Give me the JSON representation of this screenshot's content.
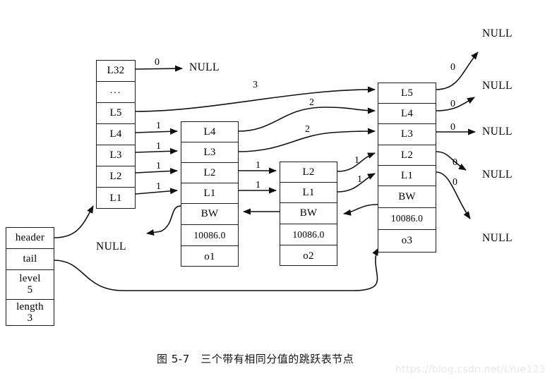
{
  "figure": {
    "caption": "图 5-7　三个带有相同分值的跳跃表节点",
    "watermark": "https://blog.csdn.net/LYue123"
  },
  "skiplist": {
    "meta_node": {
      "name": "skiplist-meta",
      "fields": [
        {
          "key": "header",
          "label": "header",
          "value": ""
        },
        {
          "key": "tail",
          "label": "tail",
          "value": ""
        },
        {
          "key": "level",
          "label": "level",
          "value": "5"
        },
        {
          "key": "length",
          "label": "length",
          "value": "3"
        }
      ]
    },
    "header_node": {
      "name": "header-node",
      "levels": [
        "L32",
        "...",
        "L5",
        "L4",
        "L3",
        "L2",
        "L1"
      ]
    },
    "nodes": [
      {
        "id": "o1",
        "levels": [
          "L4",
          "L3",
          "L2",
          "L1"
        ],
        "backward": "BW",
        "score": "10086.0",
        "obj": "o1"
      },
      {
        "id": "o2",
        "levels": [
          "L2",
          "L1"
        ],
        "backward": "BW",
        "score": "10086.0",
        "obj": "o2"
      },
      {
        "id": "o3",
        "levels": [
          "L5",
          "L4",
          "L3",
          "L2",
          "L1"
        ],
        "backward": "BW",
        "score": "10086.0",
        "obj": "o3"
      }
    ],
    "null_labels": [
      {
        "id": "null-header-l32",
        "text": "NULL"
      },
      {
        "id": "null-o1-backward",
        "text": "NULL"
      },
      {
        "id": "null-o3-l5",
        "text": "NULL"
      },
      {
        "id": "null-o3-l4",
        "text": "NULL"
      },
      {
        "id": "null-o3-l3",
        "text": "NULL"
      },
      {
        "id": "null-o3-l2",
        "text": "NULL"
      },
      {
        "id": "null-o3-l1",
        "text": "NULL"
      }
    ],
    "span_labels": [
      {
        "id": "span-header-l32",
        "value": "0"
      },
      {
        "id": "span-header-l5",
        "value": "3"
      },
      {
        "id": "span-header-l4",
        "value": "1"
      },
      {
        "id": "span-header-l3",
        "value": "1"
      },
      {
        "id": "span-header-l2",
        "value": "1"
      },
      {
        "id": "span-header-l1",
        "value": "1"
      },
      {
        "id": "span-o1-l4",
        "value": "2"
      },
      {
        "id": "span-o1-l3",
        "value": "2"
      },
      {
        "id": "span-o1-l2",
        "value": "1"
      },
      {
        "id": "span-o1-l1",
        "value": "1"
      },
      {
        "id": "span-o2-l2",
        "value": "1"
      },
      {
        "id": "span-o2-l1",
        "value": "1"
      },
      {
        "id": "span-o3-l5",
        "value": "0"
      },
      {
        "id": "span-o3-l4",
        "value": "0"
      },
      {
        "id": "span-o3-l3",
        "value": "0"
      },
      {
        "id": "span-o3-l2",
        "value": "0"
      },
      {
        "id": "span-o3-l1",
        "value": "0"
      }
    ]
  }
}
